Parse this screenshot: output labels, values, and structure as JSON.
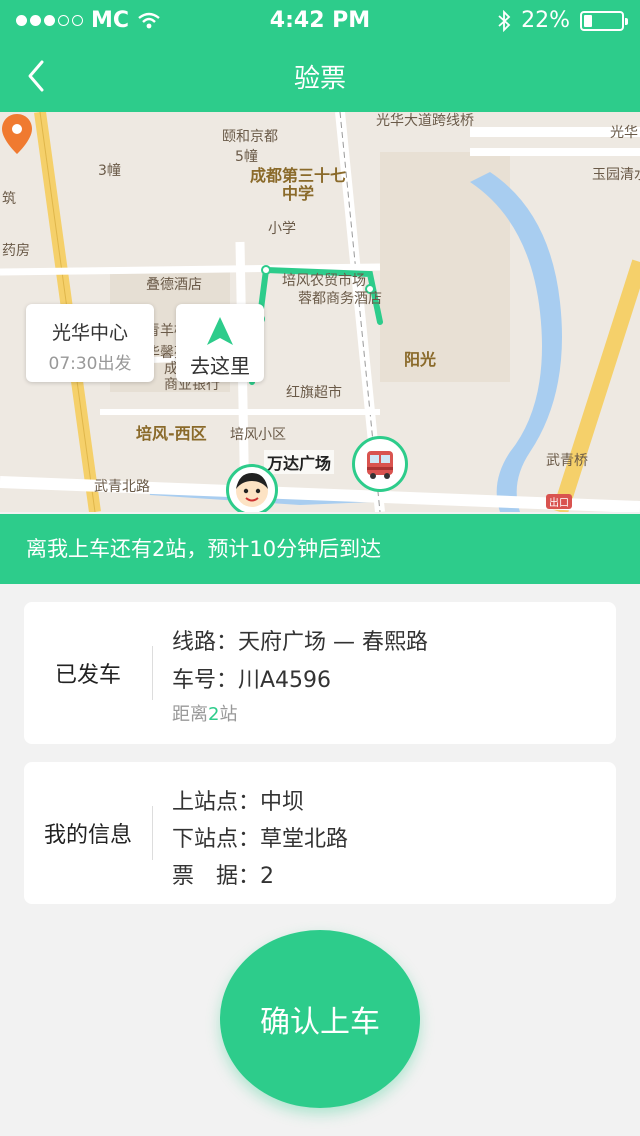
{
  "status_bar": {
    "carrier": "MC",
    "time": "4:42 PM",
    "battery": "22%",
    "battery_level": 0.22
  },
  "header": {
    "title": "验票"
  },
  "map": {
    "labels": [
      "颐和京都",
      "5幢",
      "3幢",
      "成都第三十七",
      "中学",
      "小学",
      "培风农贸市场",
      "蓉都商务酒店",
      "叠德酒店",
      "青羊杨记诊所",
      "光华馨苑小区",
      "成都市农村",
      "商业银行",
      "红旗超市",
      "培风-西区",
      "培风小区",
      "武青北路",
      "武青桥",
      "光华",
      "玉园清水河",
      "光华大道跨线桥",
      "阳光",
      "药房",
      "筑",
      "出口"
    ],
    "start_stop": {
      "name": "光华中心",
      "time": "07:30出发"
    },
    "go_label": "去这里",
    "station_label": "万达广场"
  },
  "info_bar": {
    "text": "离我上车还有2站，预计10分钟后到达"
  },
  "bus_card": {
    "status_label": "已发车",
    "route": "线路：天府广场 — 春熙路",
    "plate": "车号：川A4596",
    "distance_prefix": "距离",
    "distance_count": "2",
    "distance_suffix": "站"
  },
  "my_info_card": {
    "label": "我的信息",
    "board": "上站点：中坝",
    "alight": "下站点：草堂北路",
    "tickets": "票　据：2"
  },
  "confirm_button": {
    "label": "确认上车"
  },
  "colors": {
    "accent": "#2dcc8b",
    "map_bg": "#eee9e2",
    "water": "#a8cdf0",
    "road_yellow": "#f5d06a"
  }
}
